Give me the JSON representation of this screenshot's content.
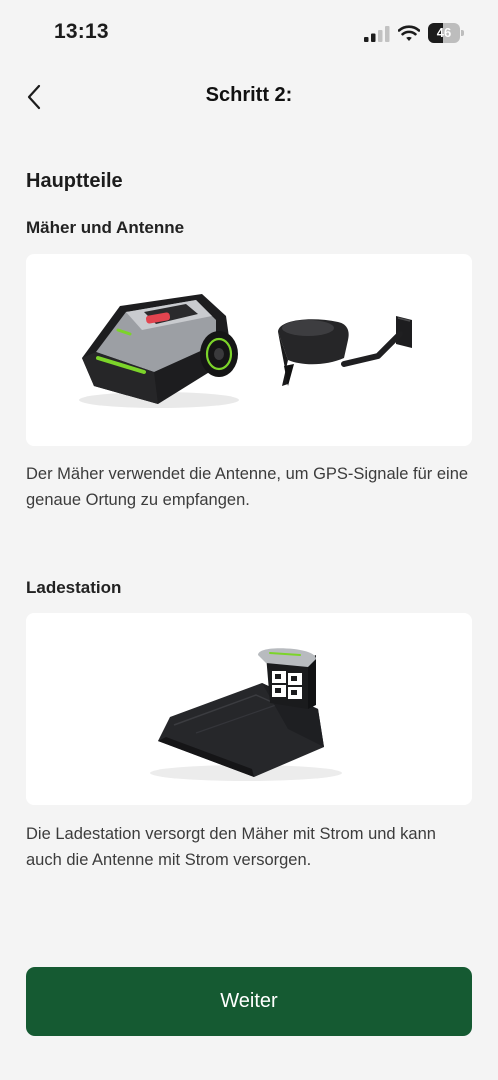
{
  "status_bar": {
    "time": "13:13",
    "battery_text": "46",
    "battery_level": 0.46,
    "signal_bars_active": 2,
    "signal_bars_total": 4
  },
  "header": {
    "back_icon": "chevron-left-icon",
    "title": "Schritt 2:"
  },
  "content": {
    "section_title": "Hauptteile",
    "items": [
      {
        "heading": "Mäher und Antenne",
        "image": "robot-mower-and-gps-antenna",
        "description": "Der Mäher verwendet die Antenne, um GPS-Signale für eine genaue Ortung zu empfangen."
      },
      {
        "heading": "Ladestation",
        "image": "charging-station",
        "description": "Die Ladestation versorgt den Mäher mit Strom und kann auch die Antenne mit Strom versorgen."
      }
    ]
  },
  "footer": {
    "next_label": "Weiter"
  },
  "colors": {
    "primary": "#155a32",
    "background": "#f4f4f4",
    "card": "#ffffff",
    "mower_accent": "#7cd42a"
  }
}
